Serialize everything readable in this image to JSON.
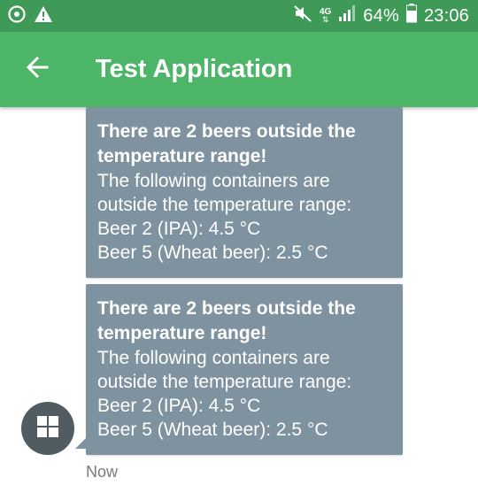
{
  "status_bar": {
    "network_label": "4G",
    "battery_percent": "64%",
    "time": "23:06",
    "icons": [
      "sync-alert-icon",
      "warning-icon",
      "mute-icon",
      "network-icon",
      "signal-icon",
      "battery-icon"
    ]
  },
  "app_bar": {
    "title": "Test Application",
    "back_icon": "arrow-left-icon"
  },
  "messages": [
    {
      "title": "There are 2 beers outside the temperature range!",
      "lines": [
        "The following containers are",
        "outside the temperature range:",
        "Beer 2 (IPA): 4.5 °C",
        "Beer 5 (Wheat beer): 2.5 °C"
      ]
    },
    {
      "title": "There are 2 beers outside the temperature range!",
      "lines": [
        "The following containers are",
        "outside the temperature range:",
        "Beer 2 (IPA): 4.5 °C",
        "Beer 5 (Wheat beer): 2.5 °C"
      ]
    }
  ],
  "timestamp": "Now",
  "avatar_icon": "grid-icon",
  "colors": {
    "status_bar": "#3f9a58",
    "app_bar": "#4cb567",
    "bubble": "#7e939f",
    "avatar": "#505b62"
  }
}
